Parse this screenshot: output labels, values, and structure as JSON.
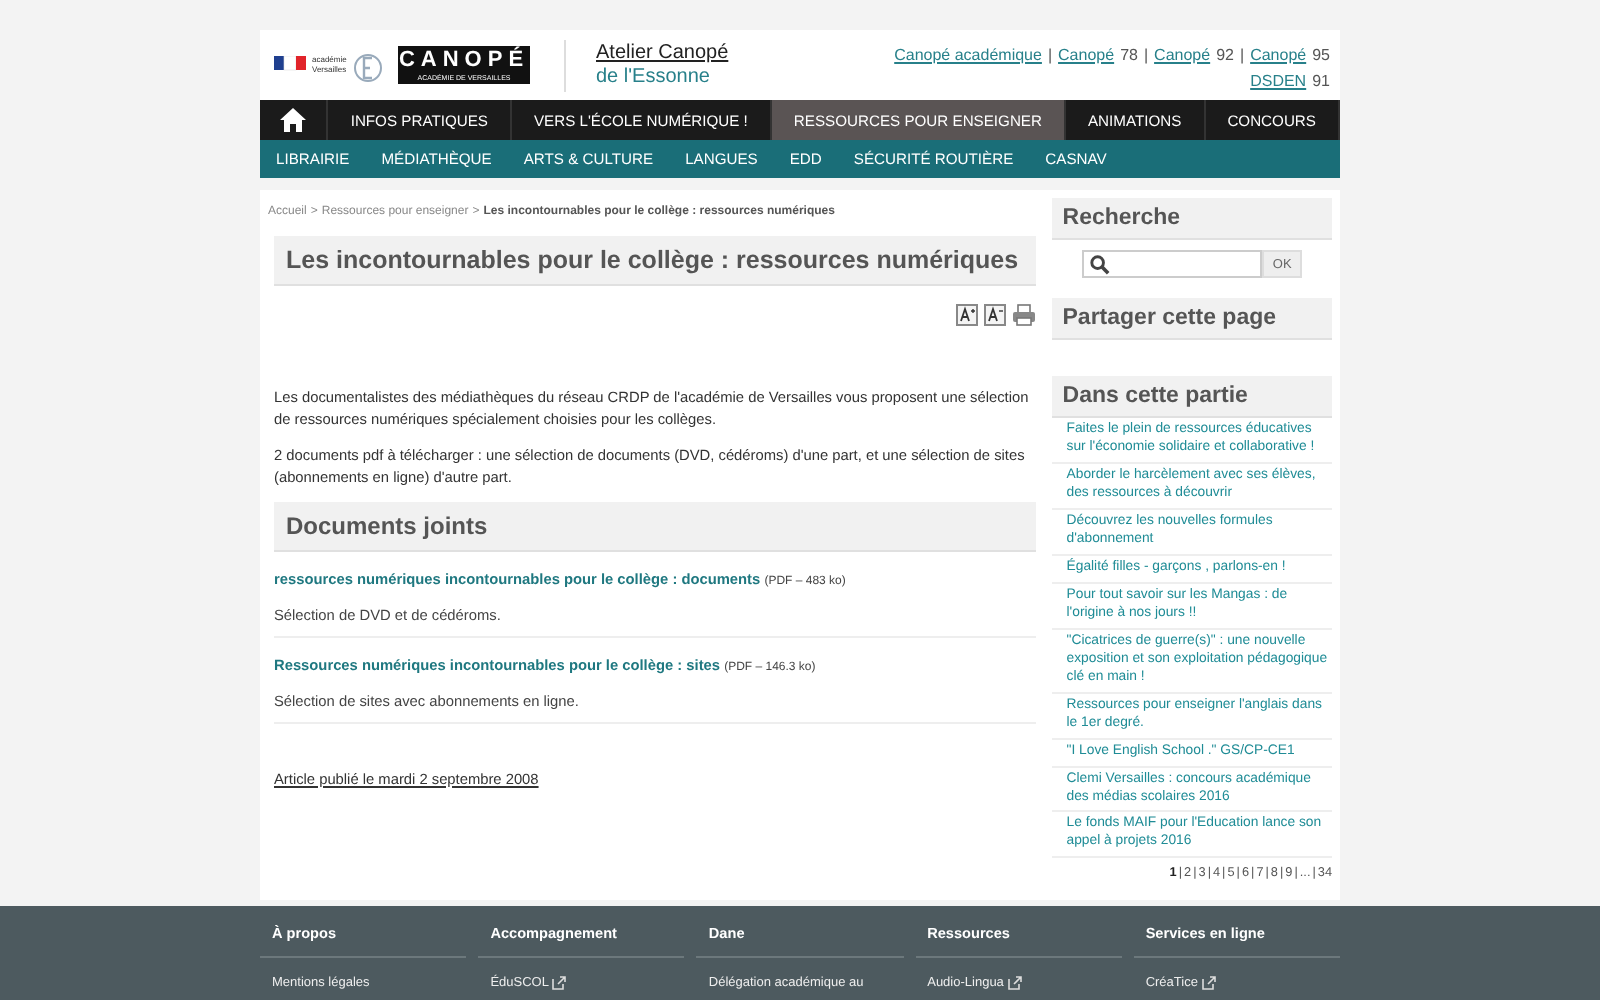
{
  "header": {
    "logo_academie": "académie Versailles",
    "logo_canope": "CANOPÉ",
    "logo_canope_sub": "ACADÉMIE DE VERSAILLES",
    "site_title": "Atelier Canopé",
    "site_subtitle": "de l'Essonne",
    "separator": "|",
    "top_links": [
      {
        "link": "Canopé académique"
      },
      {
        "link": "Canopé",
        "number": "78"
      },
      {
        "link": "Canopé",
        "number": "92"
      },
      {
        "link": "Canopé",
        "number": "95"
      }
    ],
    "second_link": {
      "link": "DSDEN",
      "number": "91"
    }
  },
  "main_nav": [
    {
      "label": "INFOS PRATIQUES",
      "selected": false
    },
    {
      "label": "VERS L'ÉCOLE NUMÉRIQUE !",
      "selected": false
    },
    {
      "label": "RESSOURCES POUR ENSEIGNER",
      "selected": true
    },
    {
      "label": "ANIMATIONS",
      "selected": false
    },
    {
      "label": "CONCOURS",
      "selected": false
    }
  ],
  "sub_nav": [
    "LIBRAIRIE",
    "MÉDIATHÈQUE",
    "ARTS & CULTURE",
    "LANGUES",
    "EDD",
    "SÉCURITÉ ROUTIÈRE",
    "CASNAV"
  ],
  "breadcrumb": {
    "items": [
      "Accueil",
      "Ressources pour enseigner"
    ],
    "separator": ">",
    "current": "Les incontournables pour le collège : ressources numériques"
  },
  "article": {
    "title": "Les incontournables pour le collège : ressources numériques",
    "paragraphs": [
      "Les documentalistes des médiathèques du réseau CRDP de l'académie de Versailles vous proposent une sélection de ressources numériques spécialement choisies pour les collèges.",
      "2 documents pdf à télécharger : une sélection de documents (DVD, cédéroms) d'une part, et une sélection de sites (abonnements en ligne) d'autre part."
    ],
    "attachments_title": "Documents joints",
    "attachments": [
      {
        "link": "ressources numériques incontournables pour le collège : documents",
        "meta": "(PDF – 483 ko)",
        "description": "Sélection de DVD et de cédéroms."
      },
      {
        "link": "Ressources numériques incontournables pour le collège : sites",
        "meta": "(PDF – 146.3 ko)",
        "description": "Sélection de sites avec abonnements en ligne."
      }
    ],
    "published": "Article publié le mardi 2 septembre 2008"
  },
  "sidebar": {
    "search_title": "Recherche",
    "search_button": "OK",
    "share_title": "Partager cette page",
    "section_title": "Dans cette partie",
    "links": [
      "Faites le plein de ressources éducatives sur l'économie solidaire et collaborative !",
      "Aborder le harcèlement avec ses élèves, des ressources à découvrir",
      "Découvrez les nouvelles formules d'abonnement",
      "Égalité filles - garçons , parlons-en !",
      "Pour tout savoir sur les Mangas : de l'origine à nos jours !!",
      "\"Cicatrices de guerre(s)\" : une nouvelle exposition et son exploitation pédagogique clé en main !",
      "Ressources pour enseigner l'anglais dans le 1er degré.",
      "\"I Love English School .\" GS/CP-CE1",
      "Clemi Versailles : concours académique des médias scolaires 2016",
      "Le fonds MAIF pour l'Education lance son appel à projets 2016"
    ],
    "pagination": [
      {
        "label": "1",
        "selected": true
      },
      {
        "label": "2",
        "selected": false
      },
      {
        "label": "3",
        "selected": false
      },
      {
        "label": "4",
        "selected": false
      },
      {
        "label": "5",
        "selected": false
      },
      {
        "label": "6",
        "selected": false
      },
      {
        "label": "7",
        "selected": false
      },
      {
        "label": "8",
        "selected": false
      },
      {
        "label": "9",
        "selected": false
      },
      {
        "label": "...",
        "selected": false
      },
      {
        "label": "34",
        "selected": false
      }
    ]
  },
  "footer": [
    {
      "heading": "À propos",
      "link": "Mentions légales",
      "external": false
    },
    {
      "heading": "Accompagnement",
      "link": "ÉduSCOL",
      "external": true
    },
    {
      "heading": "Dane",
      "link": "Délégation académique au",
      "external": false
    },
    {
      "heading": "Ressources",
      "link": "Audio-Lingua",
      "external": true
    },
    {
      "heading": "Services en ligne",
      "link": "CréaTice",
      "external": true
    }
  ]
}
